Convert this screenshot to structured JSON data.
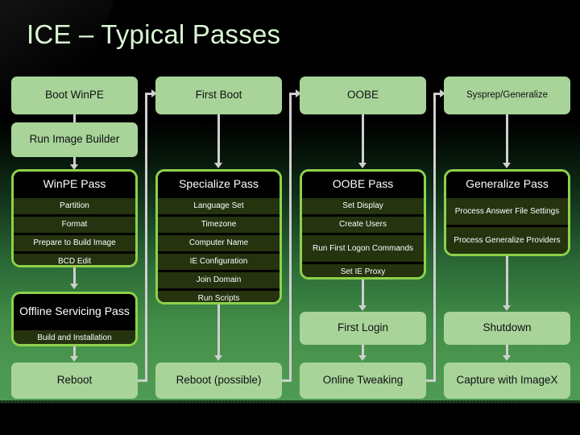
{
  "slide": {
    "title": "ICE – Typical Passes",
    "title_color": "#d9f7d2",
    "accent_border": "#8ed14b",
    "node_fill": "#a8d49a",
    "pass_row_fill": "#25330f",
    "connector_color": "#cfcfcf"
  },
  "columns": [
    {
      "top": "Boot WinPE",
      "second": "Run Image Builder",
      "pass": {
        "header": "WinPE Pass",
        "rows": [
          "Partition",
          "Format",
          "Prepare to Build Image",
          "BCD Edit"
        ]
      },
      "pass2": {
        "header": "Offline Servicing Pass",
        "rows": [
          "Build and Installation"
        ]
      },
      "bottom": "Reboot"
    },
    {
      "top": "First Boot",
      "pass": {
        "header": "Specialize Pass",
        "rows": [
          "Language Set",
          "Timezone",
          "Computer Name",
          "IE Configuration",
          "Join Domain",
          "Run Scripts"
        ]
      },
      "bottom": "Reboot (possible)"
    },
    {
      "top": "OOBE",
      "pass": {
        "header": "OOBE Pass",
        "rows": [
          "Set Display",
          "Create Users",
          "Run First Logon Commands",
          "Set IE Proxy"
        ]
      },
      "mid": "First Login",
      "bottom": "Online Tweaking"
    },
    {
      "top": "Sysprep/Generalize",
      "pass": {
        "header": "Generalize Pass",
        "rows": [
          "Process Answer File Settings",
          "Process Generalize Providers"
        ]
      },
      "mid": "Shutdown",
      "bottom": "Capture with ImageX"
    }
  ]
}
